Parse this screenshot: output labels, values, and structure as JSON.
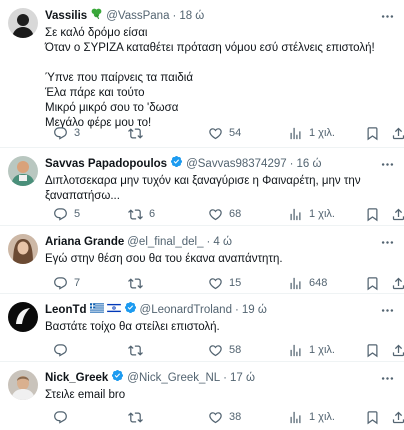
{
  "tweets": [
    {
      "name": "Vassilis",
      "badge": "shamrock",
      "handle": "@VassPana",
      "time": "18 ώ",
      "text": "Σε καλό δρόμο είσαι\nΌταν ο ΣΥΡΙΖΑ καταθέτει πρόταση νόμου εσύ στέλνεις επιστολή!\n\nΎπνε που παίρνεις τα παιδιά\nΈλα πάρε και τούτο\nΜικρό μικρό σου το 'δωσα\nΜεγάλο φέρε μου το!",
      "replies": "3",
      "retweets": "",
      "likes": "54",
      "views": "1 χιλ."
    },
    {
      "name": "Savvas Papadopoulos",
      "badge": "verified",
      "handle": "@Savvas98374297",
      "time": "16 ώ",
      "text": "Διπλοτσεκαρα μην τυχόν και ξαναγύρισε η Φαιναρέτη, μην την ξαναπατήσω...",
      "replies": "5",
      "retweets": "6",
      "likes": "68",
      "views": "1 χιλ."
    },
    {
      "name": "Ariana Grande",
      "badge": "",
      "handle": "@el_final_del_",
      "time": "4 ώ",
      "text": "Εγώ στην θέση σου θα του έκανα αναπάντητη.",
      "replies": "7",
      "retweets": "",
      "likes": "15",
      "views": "648"
    },
    {
      "name": "LeonTd",
      "badge": "flags+verified",
      "handle": "@LeonardTroland",
      "time": "19 ώ",
      "text": "Βαστάτε τοίχο θα στείλει επιστολή.",
      "replies": "",
      "retweets": "",
      "likes": "58",
      "views": "1 χιλ."
    },
    {
      "name": "Nick_Greek",
      "badge": "verified",
      "handle": "@Nick_Greek_NL",
      "time": "17 ώ",
      "text": "Στειλε email bro",
      "replies": "",
      "retweets": "",
      "likes": "38",
      "views": "1 χιλ."
    }
  ],
  "icons": {
    "more": "more-icon",
    "reply": "reply-icon",
    "retweet": "retweet-icon",
    "like": "like-icon",
    "views": "views-icon",
    "bookmark": "bookmark-icon",
    "share": "share-icon"
  },
  "colors": {
    "text": "#0f1419",
    "secondary": "#536471",
    "verified": "#1d9bf0",
    "divider": "#eff3f4"
  }
}
